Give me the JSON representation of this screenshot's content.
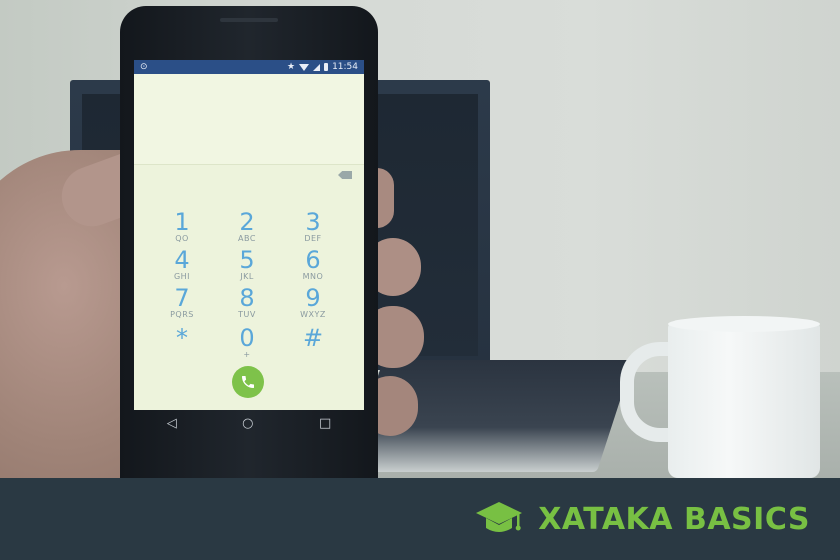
{
  "phone": {
    "status_bar": {
      "time": "11:54",
      "left_indicator": "⊙"
    },
    "keypad": [
      {
        "digit": "1",
        "letters": "QO"
      },
      {
        "digit": "2",
        "letters": "ABC"
      },
      {
        "digit": "3",
        "letters": "DEF"
      },
      {
        "digit": "4",
        "letters": "GHI"
      },
      {
        "digit": "5",
        "letters": "JKL"
      },
      {
        "digit": "6",
        "letters": "MNO"
      },
      {
        "digit": "7",
        "letters": "PQRS"
      },
      {
        "digit": "8",
        "letters": "TUV"
      },
      {
        "digit": "9",
        "letters": "WXYZ"
      },
      {
        "digit": "*",
        "letters": ""
      },
      {
        "digit": "0",
        "letters": "+"
      },
      {
        "digit": "#",
        "letters": ""
      }
    ],
    "nav": {
      "back": "◁",
      "home": "○",
      "recents": "□"
    },
    "colors": {
      "status_bar": "#2b4f87",
      "digits": "#5aa7d9",
      "call": "#7ec24a"
    }
  },
  "brand": {
    "name": "XATAKA BASICS",
    "color": "#78c043",
    "icon": "graduation-cap-icon"
  }
}
